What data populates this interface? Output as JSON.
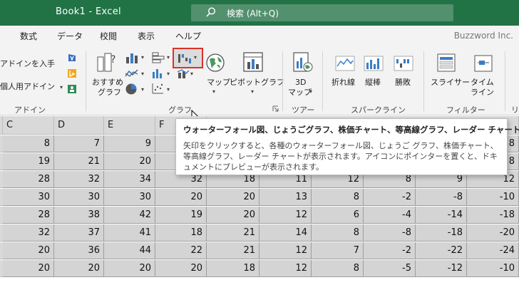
{
  "titlebar": {
    "title": "Book1  -  Excel",
    "search_placeholder": "検索 (Alt+Q)",
    "bg_color": "#217346"
  },
  "tabs": [
    "数式",
    "データ",
    "校閲",
    "表示",
    "ヘルプ"
  ],
  "brand": "Buzzword Inc.",
  "ribbon": {
    "addins": {
      "get_addins": "アドインを入手",
      "my_addins": "個人用アドイン",
      "group_label": "アドイン"
    },
    "charts": {
      "recommended_line1": "おすすめ",
      "recommended_line2": "グラフ",
      "map": "マップ",
      "pivot_chart": "ピボットグラフ",
      "group_label": "グラフ"
    },
    "tours": {
      "map3d_line1": "3D",
      "map3d_line2": "マップ",
      "group_label": "ツアー"
    },
    "sparklines": {
      "line": "折れ線",
      "column": "縦棒",
      "win_loss": "勝敗",
      "group_label": "スパークライン"
    },
    "filters": {
      "slicer": "スライサー",
      "timeline_line1": "タイム",
      "timeline_line2": "ライン",
      "group_label": "フィルター"
    },
    "links_partial": "リ"
  },
  "sheet": {
    "columns": [
      "C",
      "D",
      "E",
      "F"
    ],
    "rows": [
      [
        "8",
        "7",
        "9",
        "",
        "",
        "",
        "",
        "",
        "8"
      ],
      [
        "19",
        "21",
        "20",
        "",
        "",
        "",
        "",
        "",
        "8"
      ],
      [
        "28",
        "32",
        "34",
        "32",
        "18",
        "11",
        "12",
        "8",
        "9",
        "12"
      ],
      [
        "30",
        "30",
        "30",
        "20",
        "20",
        "13",
        "8",
        "-2",
        "-8",
        "-10"
      ],
      [
        "28",
        "38",
        "42",
        "19",
        "20",
        "12",
        "6",
        "-4",
        "-14",
        "-18"
      ],
      [
        "32",
        "37",
        "41",
        "18",
        "21",
        "14",
        "8",
        "-8",
        "-18",
        "-20"
      ],
      [
        "20",
        "36",
        "44",
        "22",
        "21",
        "12",
        "7",
        "-2",
        "-22",
        "-24"
      ],
      [
        "20",
        "20",
        "20",
        "20",
        "18",
        "12",
        "8",
        "-5",
        "-12",
        "-10"
      ]
    ]
  },
  "tooltip": {
    "title": "ウォーターフォール図、じょうごグラフ、株価チャート、等高線グラフ、レーダー チャートの挿入",
    "body": "矢印をクリックすると、各種のウォーターフォール図、じょうご グラフ、株価チャート、等高線グラフ、レーダー チャートが表示されます。アイコンにポインターを置くと、ドキュメントにプレビューが表示されます。"
  }
}
